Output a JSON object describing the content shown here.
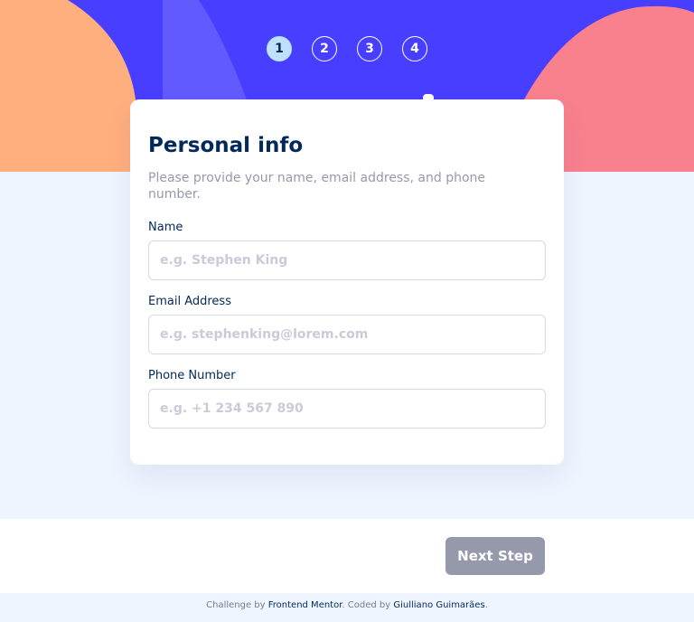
{
  "colors": {
    "hero_bg": "#483eff",
    "shape_light_purple": "#6259ff",
    "shape_orange": "#ffaf7e",
    "shape_pink": "#f9818e",
    "active_step": "#bee2fd",
    "heading": "#02295a",
    "muted": "#9699ab",
    "page_bg": "#eff5ff"
  },
  "steps": [
    {
      "number": "1",
      "active": true
    },
    {
      "number": "2",
      "active": false
    },
    {
      "number": "3",
      "active": false
    },
    {
      "number": "4",
      "active": false
    }
  ],
  "form": {
    "title": "Personal info",
    "subtitle": "Please provide your name, email address, and phone number.",
    "fields": [
      {
        "label": "Name",
        "placeholder": "e.g. Stephen King",
        "value": ""
      },
      {
        "label": "Email Address",
        "placeholder": "e.g. stephenking@lorem.com",
        "value": ""
      },
      {
        "label": "Phone Number",
        "placeholder": "e.g. +1 234 567 890",
        "value": ""
      }
    ]
  },
  "footer": {
    "next_label": "Next Step"
  },
  "attribution": {
    "prefix": "Challenge by ",
    "link1": "Frontend Mentor",
    "middle": ". Coded by ",
    "link2": "Giulliano Guimarães",
    "suffix": "."
  }
}
